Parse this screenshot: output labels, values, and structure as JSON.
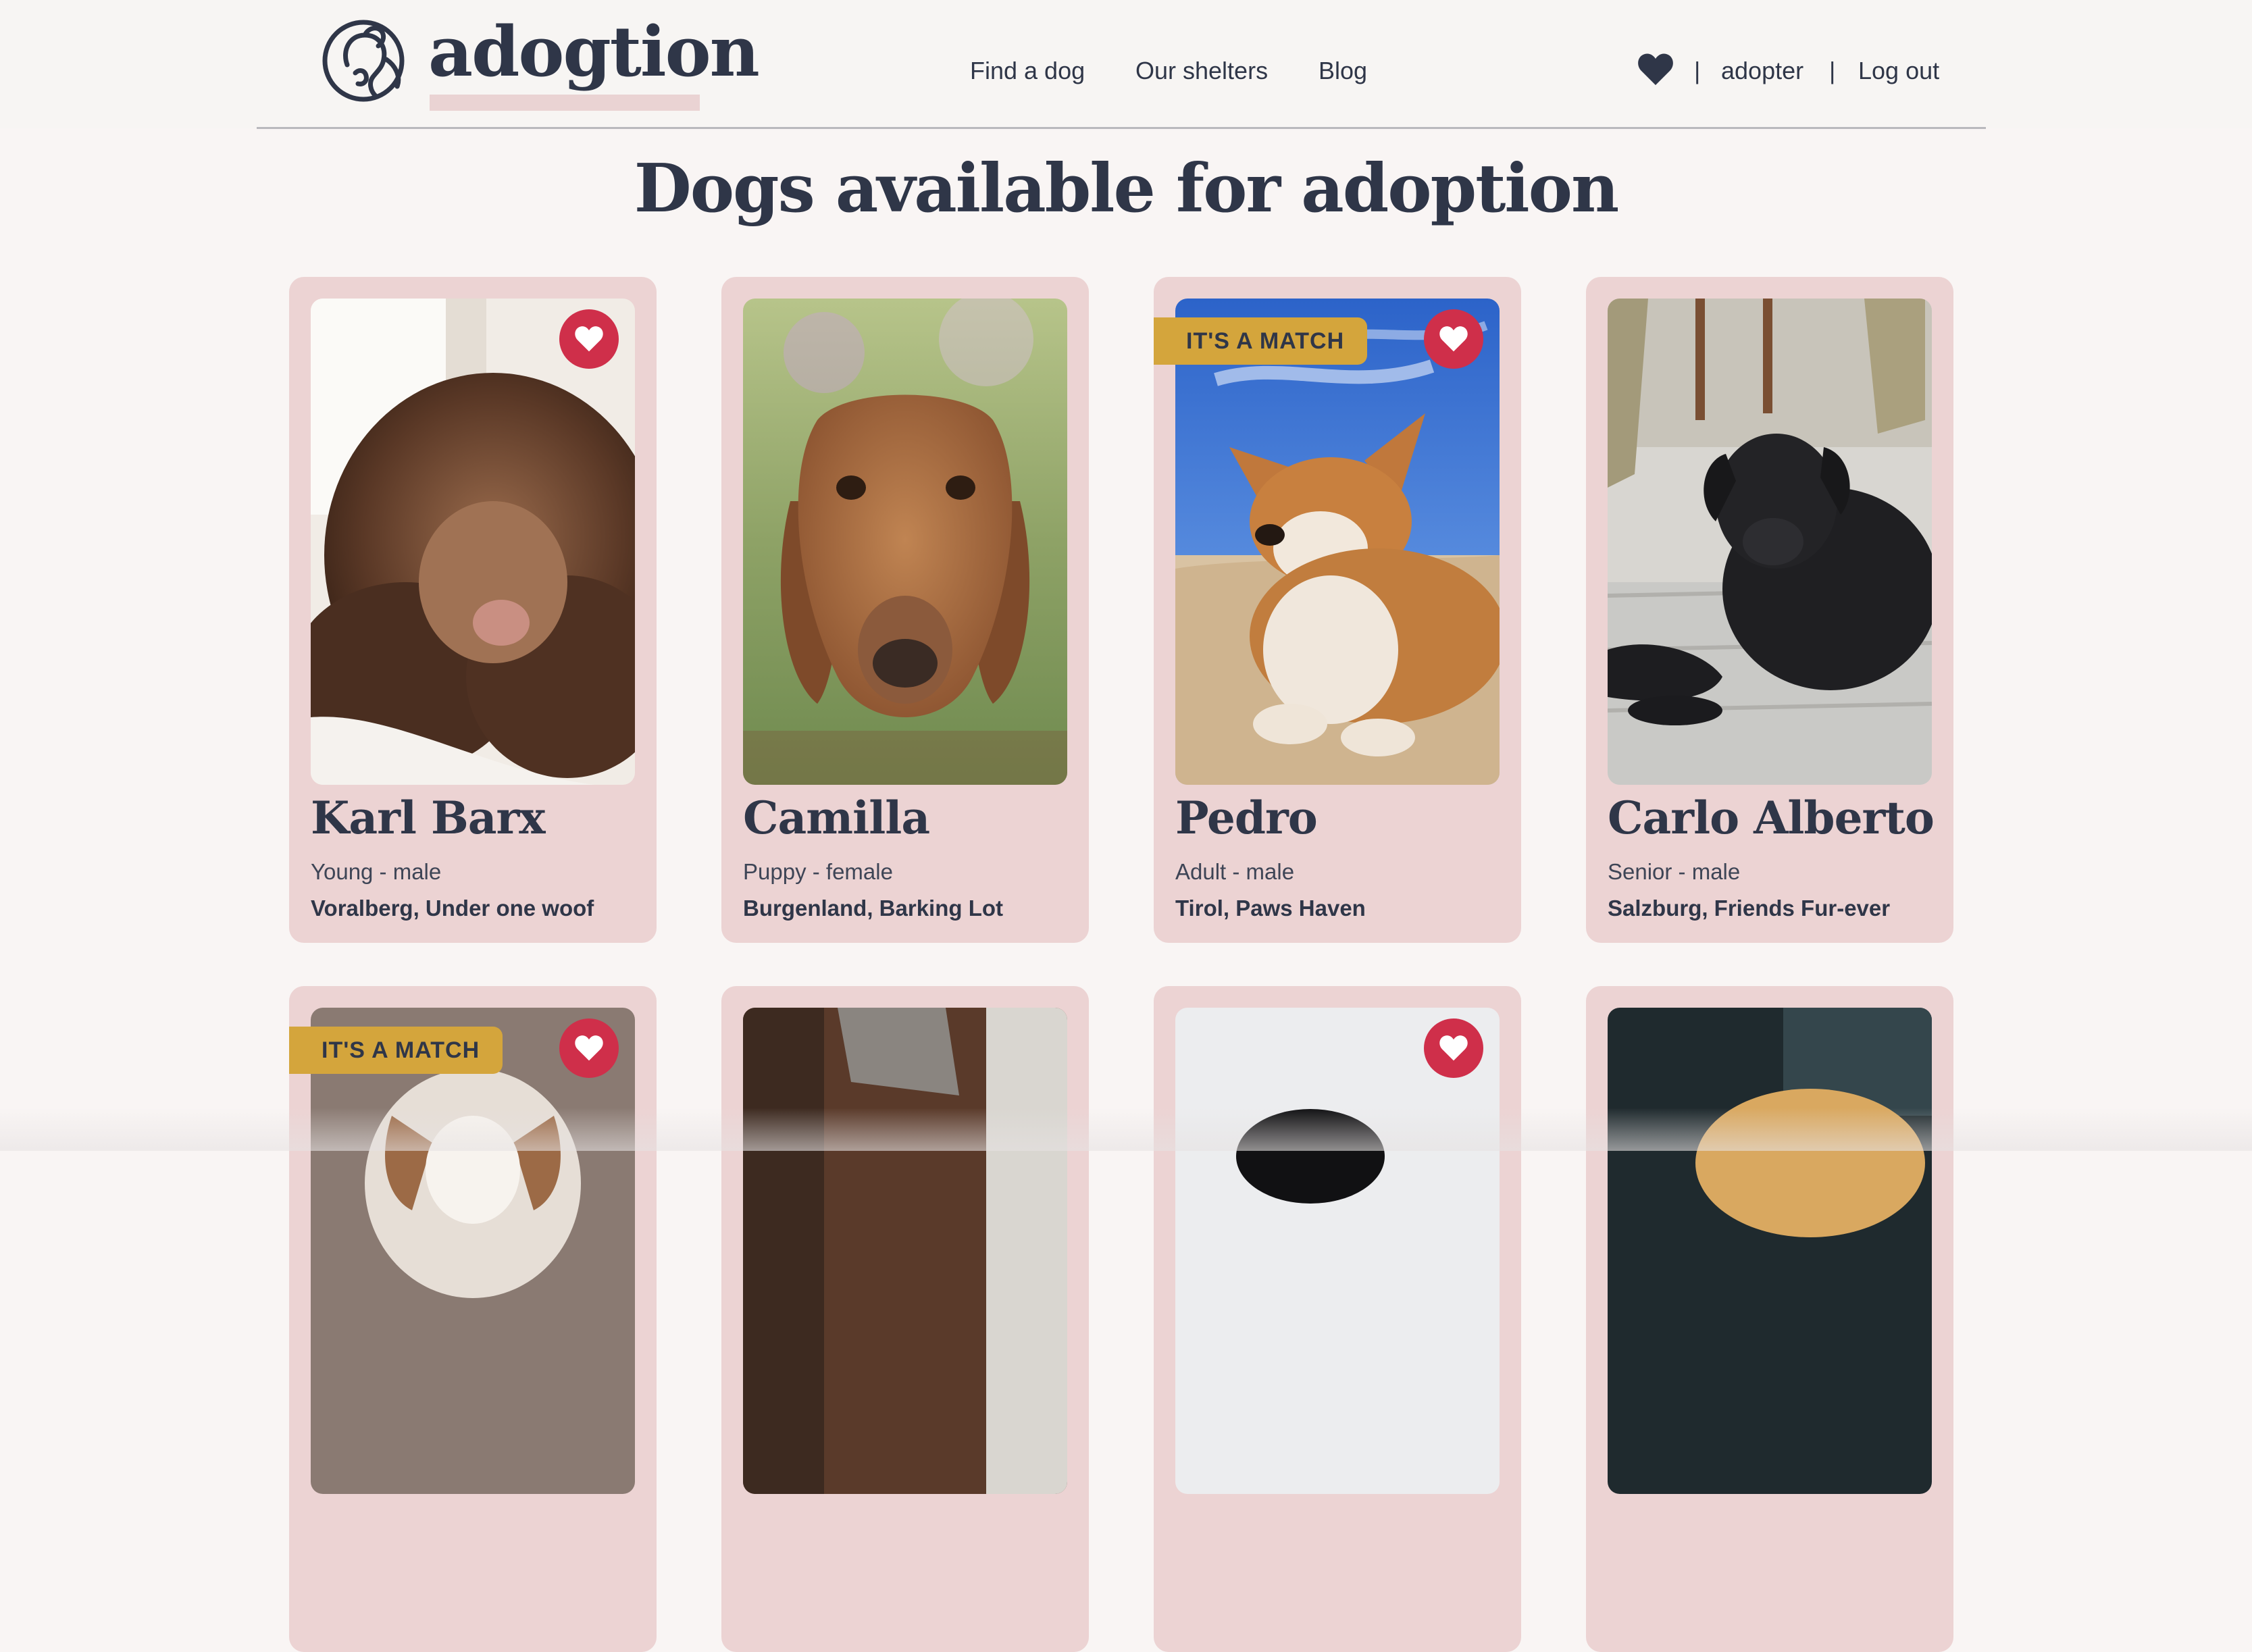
{
  "header": {
    "brand": "adogtion",
    "nav": {
      "find_dog": "Find a dog",
      "shelters": "Our shelters",
      "blog": "Blog"
    },
    "separator": "|",
    "user": "adopter",
    "logout": "Log out"
  },
  "page": {
    "title": "Dogs available for adoption"
  },
  "badge_text": "IT'S A MATCH",
  "colors": {
    "background": "#f9f5f4",
    "card": "#ecd3d3",
    "text": "#2f3648",
    "favorite": "#cf2f4a",
    "match": "#d4a53c"
  },
  "dogs": [
    {
      "name": "Karl Barx",
      "meta": "Young - male",
      "location": "Voralberg, Under one woof"
    },
    {
      "name": "Camilla",
      "meta": "Puppy - female",
      "location": "Burgenland, Barking Lot"
    },
    {
      "name": "Pedro",
      "meta": "Adult - male",
      "location": "Tirol, Paws Haven"
    },
    {
      "name": "Carlo Alberto",
      "meta": "Senior - male",
      "location": "Salzburg, Friends Fur-ever"
    }
  ],
  "icons": {
    "logo": "dog-logo-icon",
    "favorites": "heart-icon",
    "favorite_button": "heart-icon"
  }
}
